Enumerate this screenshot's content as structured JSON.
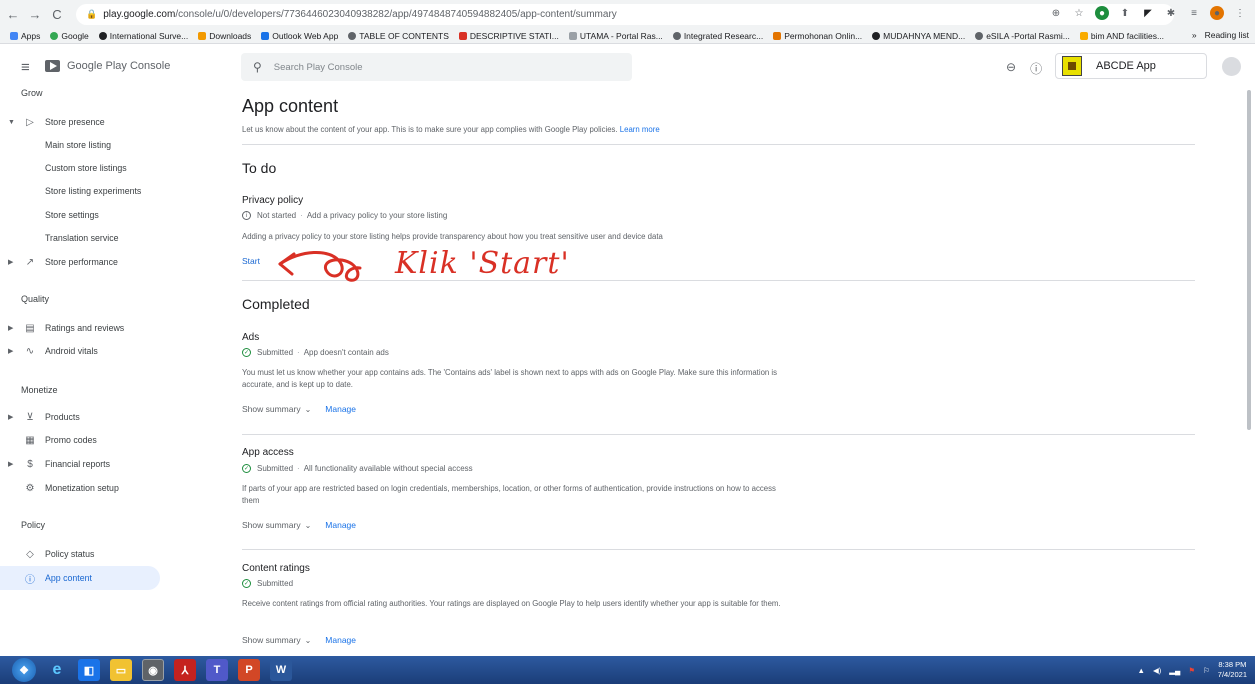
{
  "browser": {
    "url_host": "play.google.com",
    "url_path": "/console/u/0/developers/7736446023040938282/app/4974848740594882405/app-content/summary",
    "bookmarks": [
      "Apps",
      "Google",
      "International Surve...",
      "Downloads",
      "Outlook Web App",
      "TABLE OF CONTENTS",
      "DESCRIPTIVE STATI...",
      "UTAMA - Portal Ras...",
      "Integrated Researc...",
      "Permohonan Onlin...",
      "MUDAHNYA MEND...",
      "eSILA -Portal Rasmi...",
      "bim AND facilities..."
    ],
    "reading_list": "Reading list",
    "overflow": "»"
  },
  "header": {
    "brand": "Google Play Console",
    "search_placeholder": "Search Play Console",
    "app_name": "ABCDE App"
  },
  "sidebar": {
    "sections": [
      "Grow",
      "Quality",
      "Monetize",
      "Policy"
    ],
    "items": [
      {
        "label": "Store presence",
        "icon": "play-icon"
      },
      {
        "label": "Main store listing"
      },
      {
        "label": "Custom store listings"
      },
      {
        "label": "Store listing experiments"
      },
      {
        "label": "Store settings"
      },
      {
        "label": "Translation service"
      },
      {
        "label": "Store performance",
        "icon": "trend-icon"
      },
      {
        "label": "Ratings and reviews",
        "icon": "reviews-icon"
      },
      {
        "label": "Android vitals",
        "icon": "vitals-icon"
      },
      {
        "label": "Products",
        "icon": "cart-icon"
      },
      {
        "label": "Promo codes",
        "icon": "promo-icon"
      },
      {
        "label": "Financial reports",
        "icon": "dollar-icon"
      },
      {
        "label": "Monetization setup",
        "icon": "gear-icon"
      },
      {
        "label": "Policy status",
        "icon": "shield-icon"
      },
      {
        "label": "App content",
        "icon": "info-icon"
      }
    ]
  },
  "main": {
    "title": "App content",
    "subtitle": "Let us know about the content of your app. This is to make sure your app complies with Google Play policies.",
    "learn_more": "Learn more",
    "todo_heading": "To do",
    "privacy": {
      "title": "Privacy policy",
      "status": "Not started",
      "status_detail": "Add a privacy policy to your store listing",
      "desc": "Adding a privacy policy to your store listing helps provide transparency about how you treat sensitive user and device data",
      "action": "Start"
    },
    "completed_heading": "Completed",
    "ads": {
      "title": "Ads",
      "status": "Submitted",
      "status_detail": "App doesn't contain ads",
      "desc": "You must let us know whether your app contains ads. The 'Contains ads' label is shown next to apps with ads on Google Play. Make sure this information is accurate, and is kept up to date."
    },
    "access": {
      "title": "App access",
      "status": "Submitted",
      "status_detail": "All functionality available without special access",
      "desc": "If parts of your app are restricted based on login credentials, memberships, location, or other forms of authentication, provide instructions on how to access them"
    },
    "ratings": {
      "title": "Content ratings",
      "status": "Submitted",
      "desc": "Receive content ratings from official rating authorities. Your ratings are displayed on Google Play to help users identify whether your app is suitable for them."
    },
    "show_summary": "Show summary",
    "manage": "Manage"
  },
  "annotation": {
    "text": "Klik 'Start'",
    "color": "#d93025"
  },
  "taskbar": {
    "time": "8:38 PM",
    "date": "7/4/2021"
  }
}
